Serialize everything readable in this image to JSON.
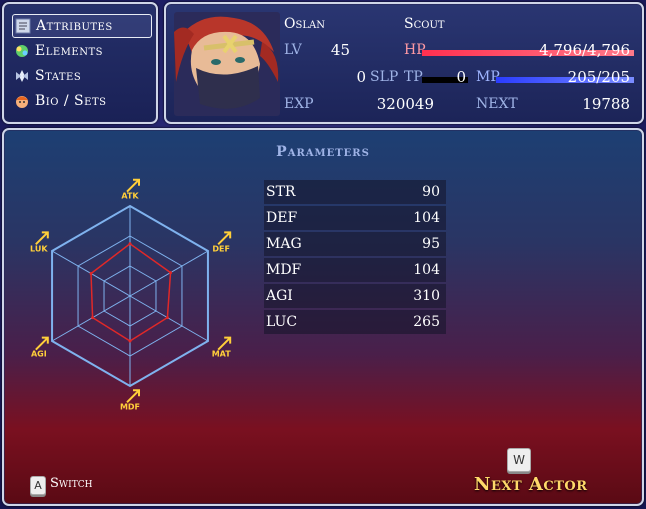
{
  "commands": {
    "items": [
      {
        "label": "Attributes",
        "icon": "attributes-icon",
        "selected": true
      },
      {
        "label": "Elements",
        "icon": "elements-icon",
        "selected": false
      },
      {
        "label": "States",
        "icon": "states-icon",
        "selected": false
      },
      {
        "label": "Bio / Sets",
        "icon": "bio-icon",
        "selected": false
      }
    ]
  },
  "actor": {
    "name": "Oslan",
    "class_name": "Scout",
    "level_label": "LV",
    "level": "45",
    "slp_value": "0",
    "slp_label": "SLP",
    "hp_label": "HP",
    "hp_text": "4,796/4,796",
    "hp_ratio": 1.0,
    "tp_label": "TP",
    "tp_value": "0",
    "tp_ratio": 0.0,
    "mp_label": "MP",
    "mp_text": "205/205",
    "mp_ratio": 1.0,
    "exp_label": "EXP",
    "exp_value": "320049",
    "next_label": "NEXT",
    "next_value": "19788"
  },
  "parameters": {
    "title": "Parameters",
    "rows": [
      {
        "name": "STR",
        "value": "90"
      },
      {
        "name": "DEF",
        "value": "104"
      },
      {
        "name": "MAG",
        "value": "95"
      },
      {
        "name": "MDF",
        "value": "104"
      },
      {
        "name": "AGI",
        "value": "310"
      },
      {
        "name": "LUC",
        "value": "265"
      }
    ]
  },
  "radar": {
    "axes": [
      "ATK",
      "DEF",
      "MAT",
      "MDF",
      "AGI",
      "LUK"
    ],
    "levels": 3,
    "values": [
      0.58,
      0.52,
      0.48,
      0.5,
      0.48,
      0.5
    ],
    "grid_color": "#7fb2ee",
    "value_color": "#e02828",
    "label_color": "#ffcf3a"
  },
  "footer": {
    "switch_key": "A",
    "switch_label": "Switch",
    "next_key": "W",
    "next_label": "Next Actor"
  },
  "colors": {
    "hp_gauge": "#ff5066",
    "mp_gauge": "#4a5cff",
    "tp_gauge": "#000000",
    "next_actor_text": "#ffd96a"
  }
}
